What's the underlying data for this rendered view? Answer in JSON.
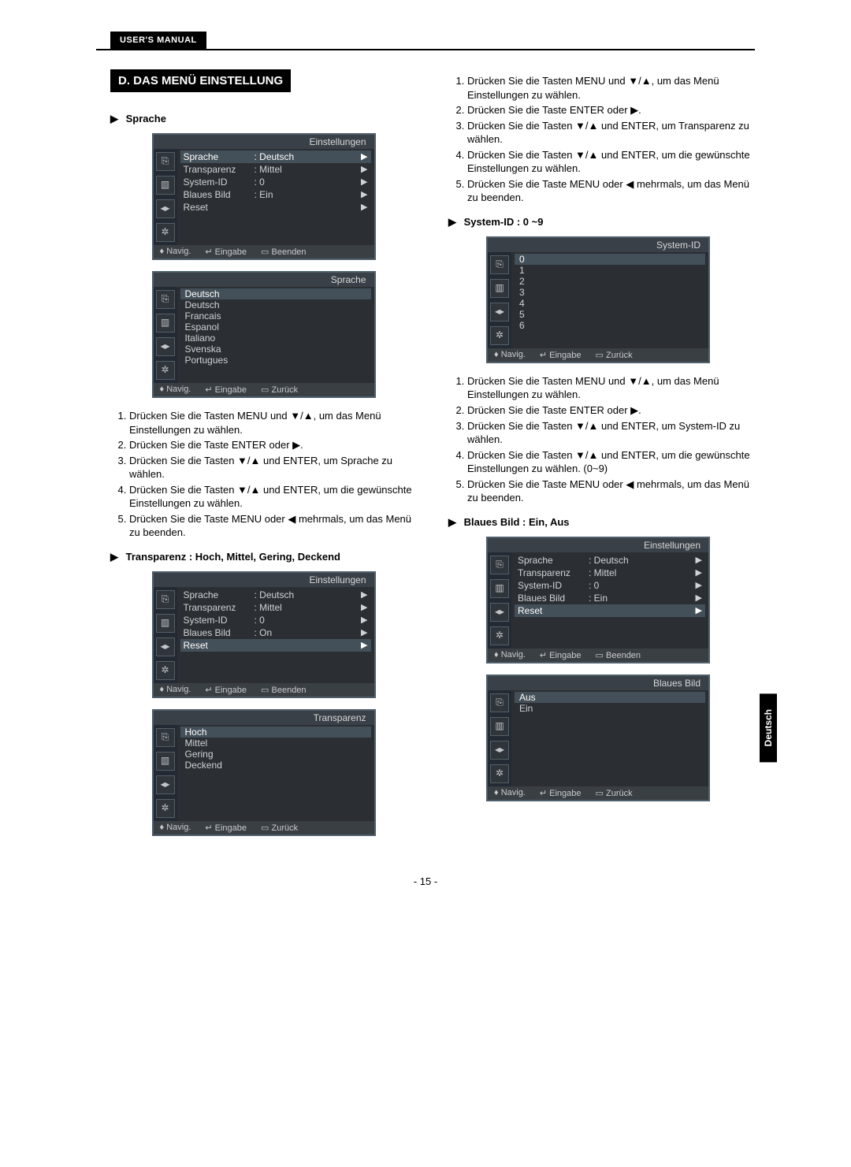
{
  "header": {
    "manual_label": "USER'S MANUAL"
  },
  "section_title": "D. DAS MENÜ EINSTELLUNG",
  "side_tab": "Deutsch",
  "page_number": "- 15 -",
  "symbols": {
    "tri_right": "▶",
    "tri_down_up": "▼/▲",
    "tri_left": "◀",
    "updown": "♦",
    "enter": "↵",
    "menu": "▭"
  },
  "left": {
    "sprache": {
      "heading": "Sprache",
      "osd1": {
        "title": "Einstellungen",
        "rows": [
          {
            "k": "Sprache",
            "v": ": Deutsch",
            "a": "▶",
            "sel": true
          },
          {
            "k": "Transparenz",
            "v": ": Mittel",
            "a": "▶"
          },
          {
            "k": "System-ID",
            "v": ": 0",
            "a": "▶"
          },
          {
            "k": "Blaues Bild",
            "v": ": Ein",
            "a": "▶"
          },
          {
            "k": "Reset",
            "v": "",
            "a": "▶"
          }
        ],
        "foot": {
          "nav": "Navig.",
          "enter": "Eingabe",
          "exit": "Beenden"
        }
      },
      "osd2": {
        "title": "Sprache",
        "items": [
          {
            "t": "Deutsch",
            "sel": true
          },
          {
            "t": "Deutsch"
          },
          {
            "t": "Francais"
          },
          {
            "t": "Espanol"
          },
          {
            "t": "Italiano"
          },
          {
            "t": "Svenska"
          },
          {
            "t": "Portugues"
          }
        ],
        "foot": {
          "nav": "Navig.",
          "enter": "Eingabe",
          "exit": "Zurück"
        }
      },
      "steps": [
        "Drücken Sie die Tasten MENU und ▼/▲, um das Menü Einstellungen zu wählen.",
        "Drücken Sie die Taste ENTER oder ▶.",
        "Drücken Sie die Tasten ▼/▲ und ENTER, um Sprache zu wählen.",
        "Drücken Sie die Tasten ▼/▲ und ENTER, um die gewünschte Einstellungen zu wählen.",
        "Drücken Sie die Taste MENU oder ◀ mehrmals, um das Menü zu beenden."
      ]
    },
    "transparenz": {
      "heading": "Transparenz : Hoch, Mittel, Gering, Deckend",
      "osd1": {
        "title": "Einstellungen",
        "rows": [
          {
            "k": "Sprache",
            "v": ": Deutsch",
            "a": "▶"
          },
          {
            "k": "Transparenz",
            "v": ": Mittel",
            "a": "▶"
          },
          {
            "k": "System-ID",
            "v": ": 0",
            "a": "▶"
          },
          {
            "k": "Blaues Bild",
            "v": ": On",
            "a": "▶"
          },
          {
            "k": "Reset",
            "v": "",
            "a": "▶",
            "sel": true
          }
        ],
        "foot": {
          "nav": "Navig.",
          "enter": "Eingabe",
          "exit": "Beenden"
        }
      },
      "osd2": {
        "title": "Transparenz",
        "items": [
          {
            "t": "Hoch",
            "sel": true
          },
          {
            "t": "Mittel"
          },
          {
            "t": "Gering"
          },
          {
            "t": "Deckend"
          }
        ],
        "foot": {
          "nav": "Navig.",
          "enter": "Eingabe",
          "exit": "Zurück"
        }
      }
    }
  },
  "right": {
    "trans_steps": [
      "Drücken Sie die Tasten MENU und ▼/▲, um das Menü Einstellungen zu wählen.",
      "Drücken Sie die Taste ENTER oder ▶.",
      "Drücken Sie die Tasten ▼/▲ und ENTER, um Transparenz zu wählen.",
      "Drücken Sie die Tasten ▼/▲ und ENTER, um die gewünschte Einstellungen zu wählen.",
      "Drücken Sie die Taste MENU oder ◀ mehrmals, um das Menü zu beenden."
    ],
    "systemid": {
      "heading": "System-ID : 0 ~9",
      "osd": {
        "title": "System-ID",
        "items": [
          {
            "t": "0",
            "sel": true
          },
          {
            "t": "1"
          },
          {
            "t": "2"
          },
          {
            "t": "3"
          },
          {
            "t": "4"
          },
          {
            "t": "5"
          },
          {
            "t": "6"
          }
        ],
        "foot": {
          "nav": "Navig.",
          "enter": "Eingabe",
          "exit": "Zurück"
        }
      },
      "steps": [
        "Drücken Sie die Tasten MENU und ▼/▲, um das Menü Einstellungen zu wählen.",
        "Drücken Sie die Taste ENTER oder ▶.",
        "Drücken Sie die Tasten ▼/▲ und ENTER, um System-ID zu wählen.",
        "Drücken Sie die Tasten ▼/▲ und ENTER, um die gewünschte Einstellungen zu wählen. (0~9)",
        "Drücken Sie die Taste MENU oder ◀ mehrmals, um das Menü zu beenden."
      ]
    },
    "blauesbild": {
      "heading": "Blaues Bild : Ein, Aus",
      "osd1": {
        "title": "Einstellungen",
        "rows": [
          {
            "k": "Sprache",
            "v": ": Deutsch",
            "a": "▶"
          },
          {
            "k": "Transparenz",
            "v": ": Mittel",
            "a": "▶"
          },
          {
            "k": "System-ID",
            "v": ": 0",
            "a": "▶"
          },
          {
            "k": "Blaues Bild",
            "v": ": Ein",
            "a": "▶"
          },
          {
            "k": "Reset",
            "v": "",
            "a": "▶",
            "sel": true
          }
        ],
        "foot": {
          "nav": "Navig.",
          "enter": "Eingabe",
          "exit": "Beenden"
        }
      },
      "osd2": {
        "title": "Blaues Bild",
        "items": [
          {
            "t": "Aus",
            "sel": true
          },
          {
            "t": "Ein"
          }
        ],
        "foot": {
          "nav": "Navig.",
          "enter": "Eingabe",
          "exit": "Zurück"
        }
      }
    }
  },
  "icon_set": [
    "⎘",
    "▥",
    "◂▸",
    "✲"
  ]
}
